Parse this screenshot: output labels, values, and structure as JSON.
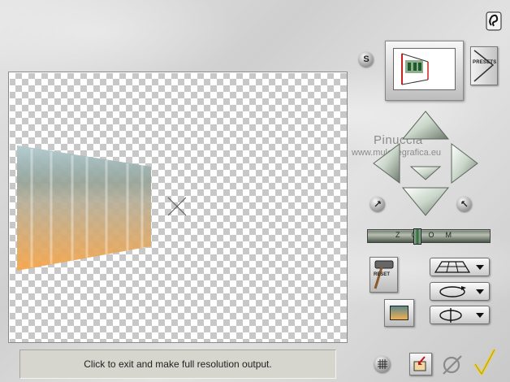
{
  "window": {
    "status_text": "Click to exit and make full resolution output."
  },
  "watermark": {
    "title": "Pinuccia",
    "url": "www.mulchegrafica.eu"
  },
  "controls": {
    "s_button_label": "S",
    "presets_label": "PRESETS",
    "zoom_label": "ZOOM",
    "reset_label": "RESET"
  },
  "icons": {
    "help": "help-icon",
    "grid": "grid-icon",
    "open": "folder-open-icon",
    "cancel": "cancel-icon",
    "ok": "checkmark-icon"
  },
  "colors": {
    "accent_ok": "#e8d23a",
    "arrow_tint": "#c9d6c9",
    "preview_gradient_top": "#5d8d95",
    "preview_gradient_bottom": "#f6a64a"
  }
}
